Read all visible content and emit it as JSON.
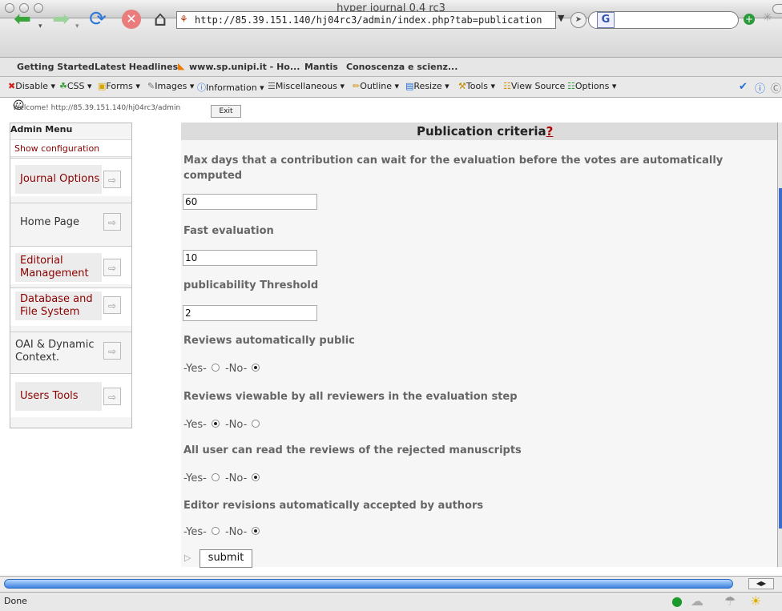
{
  "window": {
    "title": "hyper journal 0.4 rc3"
  },
  "nav": {
    "url": "http://85.39.151.140/hj04rc3/admin/index.php?tab=publication",
    "search_engine": "G"
  },
  "bookmarks": [
    "Getting Started",
    "Latest Headlines",
    "www.sp.unipi.it - Ho...",
    "Mantis",
    "Conoscenza e scienz..."
  ],
  "devbar": [
    "Disable",
    "CSS",
    "Forms",
    "Images",
    "Information",
    "Miscellaneous",
    "Outline",
    "Resize",
    "Tools",
    "View Source",
    "Options"
  ],
  "page": {
    "welcome": "Welcome! http://85.39.151.140/hj04rc3/admin",
    "exit_label": "Exit"
  },
  "sidebar": {
    "heading": "Admin Menu",
    "show_config": "Show configuration",
    "items": [
      {
        "label": "Journal Options"
      },
      {
        "label": "Home Page"
      },
      {
        "label": "Editorial Management"
      },
      {
        "label": "Database and File System"
      },
      {
        "label": "OAI & Dynamic Context."
      },
      {
        "label": "Users Tools"
      }
    ]
  },
  "form": {
    "title": "Publication criteria",
    "help_mark": "?",
    "fields": [
      {
        "label": "Max days that a contribution can wait for the evaluation before the votes are automatically computed",
        "value": "60"
      },
      {
        "label": "Fast evaluation",
        "value": "10"
      },
      {
        "label": "publicability Threshold",
        "value": "2"
      }
    ],
    "radios": [
      {
        "label": "Reviews automatically public",
        "selected": "No"
      },
      {
        "label": "Reviews viewable by all reviewers in the evaluation step",
        "selected": "Yes"
      },
      {
        "label": "All user can read the reviews of the rejected manuscripts",
        "selected": "No"
      },
      {
        "label": "Editor revisions automatically accepted by authors",
        "selected": "No"
      }
    ],
    "yes_label": "-Yes-",
    "no_label": "-No-",
    "submit_label": "submit"
  },
  "status": {
    "text": "Done"
  }
}
